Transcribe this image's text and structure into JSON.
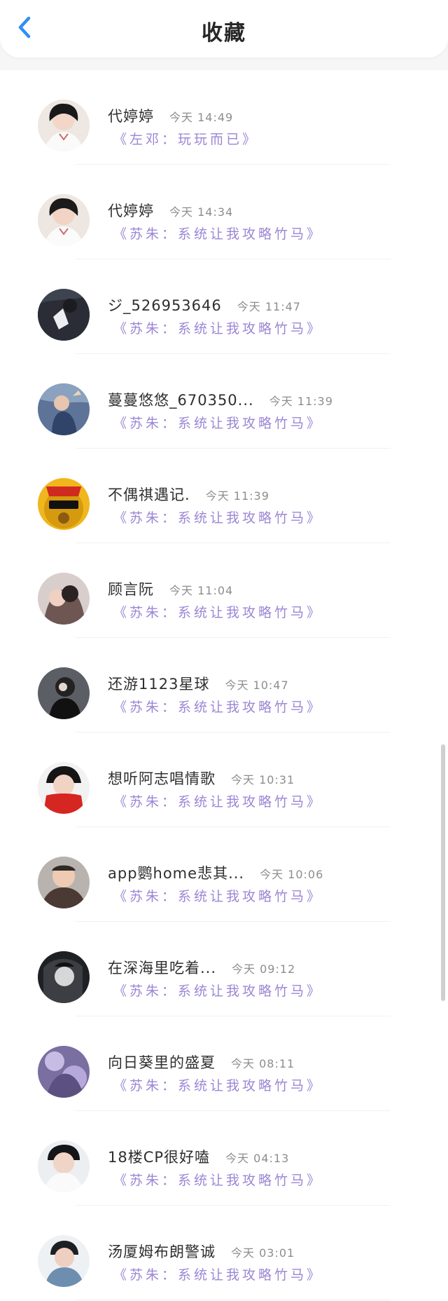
{
  "header": {
    "title": "收藏",
    "back_icon": "chevron-left-icon",
    "back_color": "#2f8ff5"
  },
  "favorites": [
    {
      "name": "代婷婷",
      "time": "今天 14:49",
      "book": "《左邓：玩玩而已》"
    },
    {
      "name": "代婷婷",
      "time": "今天 14:34",
      "book": "《苏朱：系统让我攻略竹马》"
    },
    {
      "name": "ジ_526953646",
      "time": "今天 11:47",
      "book": "《苏朱：系统让我攻略竹马》"
    },
    {
      "name": "蔓蔓悠悠_670350...",
      "time": "今天 11:39",
      "book": "《苏朱：系统让我攻略竹马》"
    },
    {
      "name": "不偶祺遇记.",
      "time": "今天 11:39",
      "book": "《苏朱：系统让我攻略竹马》"
    },
    {
      "name": "顾言阮",
      "time": "今天 11:04",
      "book": "《苏朱：系统让我攻略竹马》"
    },
    {
      "name": "还游1123星球",
      "time": "今天 10:47",
      "book": "《苏朱：系统让我攻略竹马》"
    },
    {
      "name": "想听阿志唱情歌",
      "time": "今天 10:31",
      "book": "《苏朱：系统让我攻略竹马》"
    },
    {
      "name": "app鹦home悲其...",
      "time": "今天 10:06",
      "book": "《苏朱：系统让我攻略竹马》"
    },
    {
      "name": "在深海里吃着...",
      "time": "今天 09:12",
      "book": "《苏朱：系统让我攻略竹马》"
    },
    {
      "name": "向日葵里的盛夏",
      "time": "今天 08:11",
      "book": "《苏朱：系统让我攻略竹马》"
    },
    {
      "name": "18楼CP很好嗑",
      "time": "今天 04:13",
      "book": "《苏朱：系统让我攻略竹马》"
    },
    {
      "name": "汤厦姆布朗警诚",
      "time": "今天 03:01",
      "book": "《苏朱：系统让我攻略竹马》"
    }
  ],
  "colors": {
    "name_text": "#2f2f2f",
    "time_text": "#8d8d8d",
    "book_text": "#9c86d5",
    "background": "#ffffff"
  }
}
